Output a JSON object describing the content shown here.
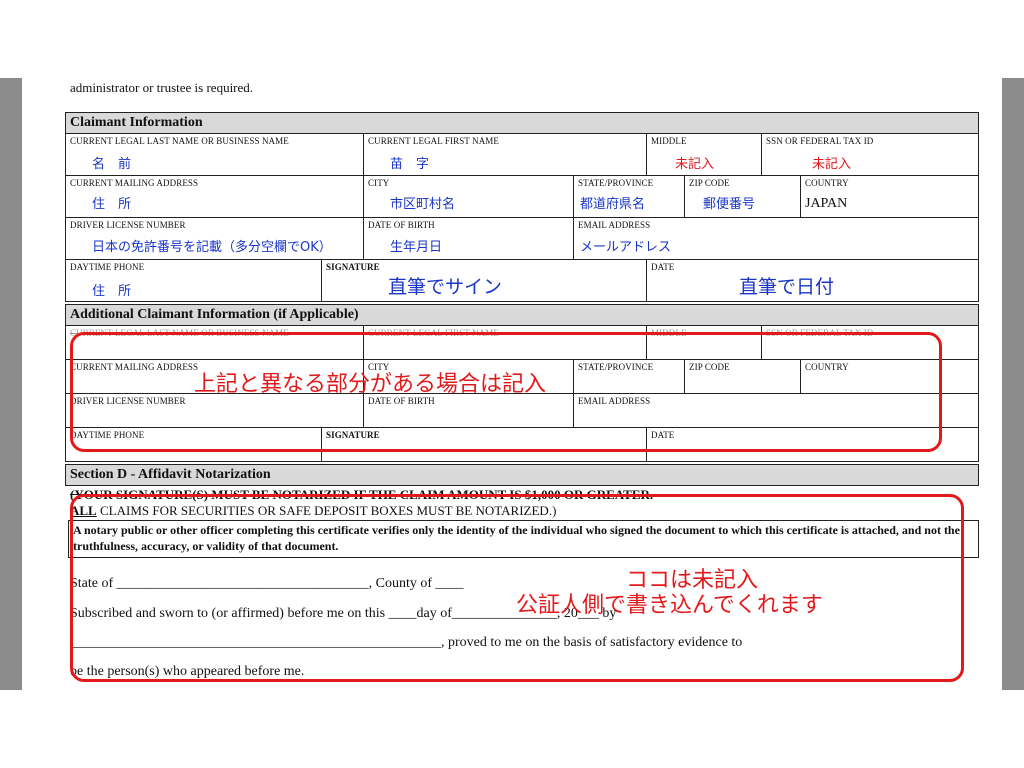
{
  "intro_text": "administrator or trustee is required.",
  "claimant": {
    "section_title": "Claimant Information",
    "last_name_label": "CURRENT LEGAL LAST NAME OR BUSINESS NAME",
    "last_name_value": "名　前",
    "first_name_label": "CURRENT LEGAL FIRST NAME",
    "first_name_value": "苗　字",
    "middle_label": "MIDDLE",
    "middle_value": "未記入",
    "ssn_label": "SSN OR FEDERAL TAX ID",
    "ssn_value": "未記入",
    "mailing_label": "CURRENT MAILING ADDRESS",
    "mailing_value": "住　所",
    "city_label": "CITY",
    "city_value": "市区町村名",
    "state_label": "STATE/PROVINCE",
    "state_value": "都道府県名",
    "zip_label": "ZIP CODE",
    "zip_value": "郵便番号",
    "country_label": "COUNTRY",
    "country_value": "JAPAN",
    "license_label": "DRIVER LICENSE NUMBER",
    "license_value": "日本の免許番号を記載（多分空欄でOK）",
    "dob_label": "DATE OF BIRTH",
    "dob_value": "生年月日",
    "email_label": "EMAIL ADDRESS",
    "email_value": "メールアドレス",
    "phone_label": "DAYTIME PHONE",
    "phone_value": "住　所",
    "signature_label": "SIGNATURE",
    "signature_value": "直筆でサイン",
    "date_label": "DATE",
    "date_value": "直筆で日付"
  },
  "additional": {
    "section_title": "Additional Claimant Information (if Applicable)",
    "last_name_label": "CURRENT LEGAL LAST NAME OR BUSINESS NAME",
    "first_name_label": "CURRENT LEGAL FIRST NAME",
    "middle_label": "MIDDLE",
    "ssn_label": "SSN OR FEDERAL TAX ID",
    "mailing_label": "CURRENT MAILING ADDRESS",
    "city_label": "CITY",
    "state_label": "STATE/PROVINCE",
    "zip_label": "ZIP CODE",
    "country_label": "COUNTRY",
    "license_label": "DRIVER LICENSE NUMBER",
    "dob_label": "DATE OF BIRTH",
    "email_label": "EMAIL ADDRESS",
    "phone_label": "DAYTIME PHONE",
    "signature_label": "SIGNATURE",
    "date_label": "DATE"
  },
  "section_d": {
    "title": "Section D - Affidavit Notarization",
    "notice_line1": "(YOUR SIGNATURE(S) MUST BE NOTARIZED IF THE CLAIM AMOUNT IS $1,000 OR GREATER.",
    "notice_all": "ALL",
    "notice_line2": " CLAIMS FOR SECURITIES OR SAFE DEPOSIT BOXES MUST BE NOTARIZED.)",
    "notary_text": "A notary public or other officer completing this certificate verifies only the identity of the individual who signed the document to which this certificate is attached, and not the truthfulness, accuracy, or validity of that document.",
    "state_line": "State of ____________________________________, County of ____",
    "sworn_line": "Subscribed and sworn to (or affirmed) before me on this ____day of_______________, 20___ by",
    "proved_line": "_____________________________________________________, proved to me on the basis of satisfactory evidence to",
    "appeared_line": "be the person(s) who appeared before me."
  },
  "annotations": {
    "additional_note": "上記と異なる部分がある場合は記入",
    "notary_note_line1": "ココは未記入",
    "notary_note_line2": "公証人側で書き込んでくれます",
    "color": "#e31a1c"
  },
  "colors": {
    "handwritten_blue": "#1a35c9",
    "handwritten_red": "#e0161c",
    "section_gray": "#d9d9d9"
  }
}
